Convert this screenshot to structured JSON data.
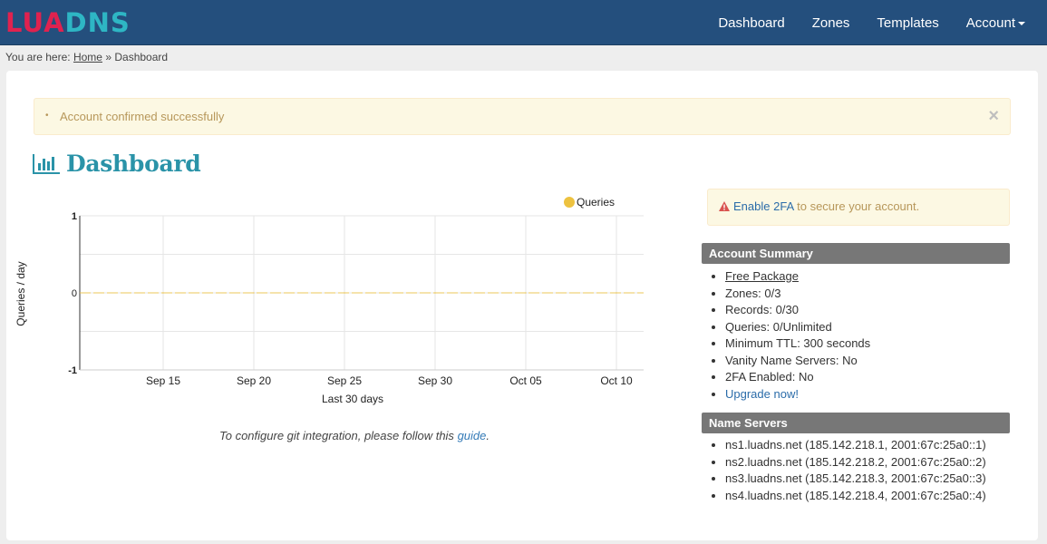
{
  "brand": {
    "part1": "LUA",
    "part2": "DNS"
  },
  "nav": {
    "dashboard": "Dashboard",
    "zones": "Zones",
    "templates": "Templates",
    "account": "Account"
  },
  "breadcrumb": {
    "prefix": "You are here:",
    "home": "Home",
    "separator": "»",
    "current": "Dashboard"
  },
  "alert": {
    "message": "Account confirmed successfully",
    "close": "×"
  },
  "page": {
    "title": "Dashboard"
  },
  "chart_data": {
    "type": "line",
    "x": [
      "Sep 15",
      "Sep 20",
      "Sep 25",
      "Sep 30",
      "Oct 05",
      "Oct 10"
    ],
    "series": [
      {
        "name": "Queries",
        "values": [
          0,
          0,
          0,
          0,
          0,
          0
        ],
        "color": "#edc240"
      }
    ],
    "xlabel": "Last 30 days",
    "ylabel": "Queries / day",
    "yticks": [
      "1",
      "0",
      "-1"
    ],
    "ylim": [
      -1,
      1
    ],
    "grid": true,
    "legend": "top-right"
  },
  "git": {
    "prefix": "To configure git integration, please follow this ",
    "link": "guide",
    "suffix": "."
  },
  "twofa": {
    "link": "Enable 2FA",
    "text": " to secure your account."
  },
  "account_summary": {
    "title": "Account Summary",
    "package": "Free Package",
    "zones": "Zones: 0/3",
    "records": "Records: 0/30",
    "queries": "Queries: 0/Unlimited",
    "ttl": "Minimum TTL: 300 seconds",
    "vanity": "Vanity Name Servers: No",
    "twofa": "2FA Enabled: No",
    "upgrade": "Upgrade now!"
  },
  "name_servers": {
    "title": "Name Servers",
    "items": [
      "ns1.luadns.net (185.142.218.1, 2001:67c:25a0::1)",
      "ns2.luadns.net (185.142.218.2, 2001:67c:25a0::2)",
      "ns3.luadns.net (185.142.218.3, 2001:67c:25a0::3)",
      "ns4.luadns.net (185.142.218.4, 2001:67c:25a0::4)"
    ]
  }
}
